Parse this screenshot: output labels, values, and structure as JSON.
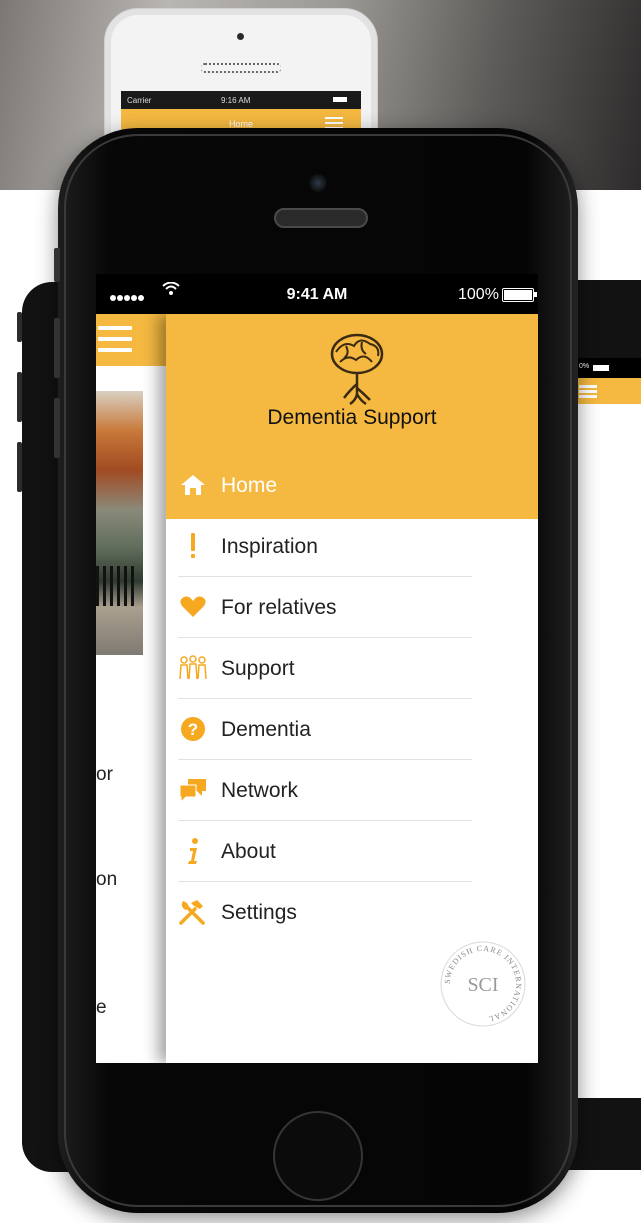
{
  "background_phone": {
    "carrier": "Carrier",
    "time": "9:16 AM",
    "title": "Home"
  },
  "right_phone": {
    "battery": "0%"
  },
  "status_bar": {
    "time": "9:41 AM",
    "battery": "100%"
  },
  "content_pane": {
    "text_fragments": [
      "or",
      "on",
      "e"
    ]
  },
  "drawer": {
    "app_title": "Dementia Support",
    "items": [
      {
        "label": "Home",
        "icon": "home-icon",
        "active": true
      },
      {
        "label": "Inspiration",
        "icon": "exclamation-icon",
        "active": false
      },
      {
        "label": "For relatives",
        "icon": "heart-icon",
        "active": false
      },
      {
        "label": "Support",
        "icon": "people-icon",
        "active": false
      },
      {
        "label": "Dementia",
        "icon": "question-icon",
        "active": false
      },
      {
        "label": "Network",
        "icon": "chat-icon",
        "active": false
      },
      {
        "label": "About",
        "icon": "info-icon",
        "active": false
      },
      {
        "label": "Settings",
        "icon": "tools-icon",
        "active": false
      }
    ]
  },
  "logo": {
    "initials": "SCI",
    "ring_text": "SWEDISH CARE INTERNATIONAL"
  },
  "colors": {
    "accent": "#f5b941",
    "icon": "#f5a820"
  }
}
